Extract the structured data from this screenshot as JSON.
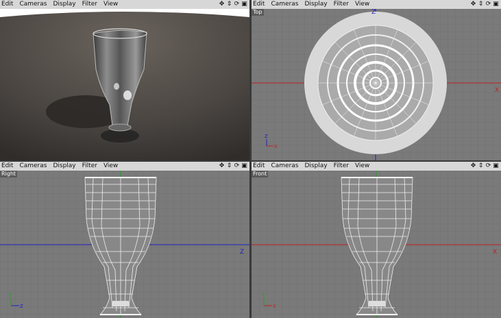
{
  "menu": {
    "edit": "Edit",
    "cameras": "Cameras",
    "display": "Display",
    "filter": "Filter",
    "view": "View"
  },
  "viewports": {
    "perspective": {
      "label": ""
    },
    "top": {
      "label": "Top"
    },
    "right": {
      "label": "Right"
    },
    "front": {
      "label": "Front"
    }
  },
  "axes": {
    "x": "X",
    "y": "Y",
    "z": "Z"
  },
  "colors": {
    "menubar": "#d7d7d7",
    "grid_bg": "#7a7a7a",
    "x_axis": "#c02020",
    "z_axis": "#2020c0",
    "y_axis": "#20a020"
  },
  "icons": [
    "move-icon",
    "dolly-icon",
    "rotate-icon",
    "maximize-icon"
  ]
}
